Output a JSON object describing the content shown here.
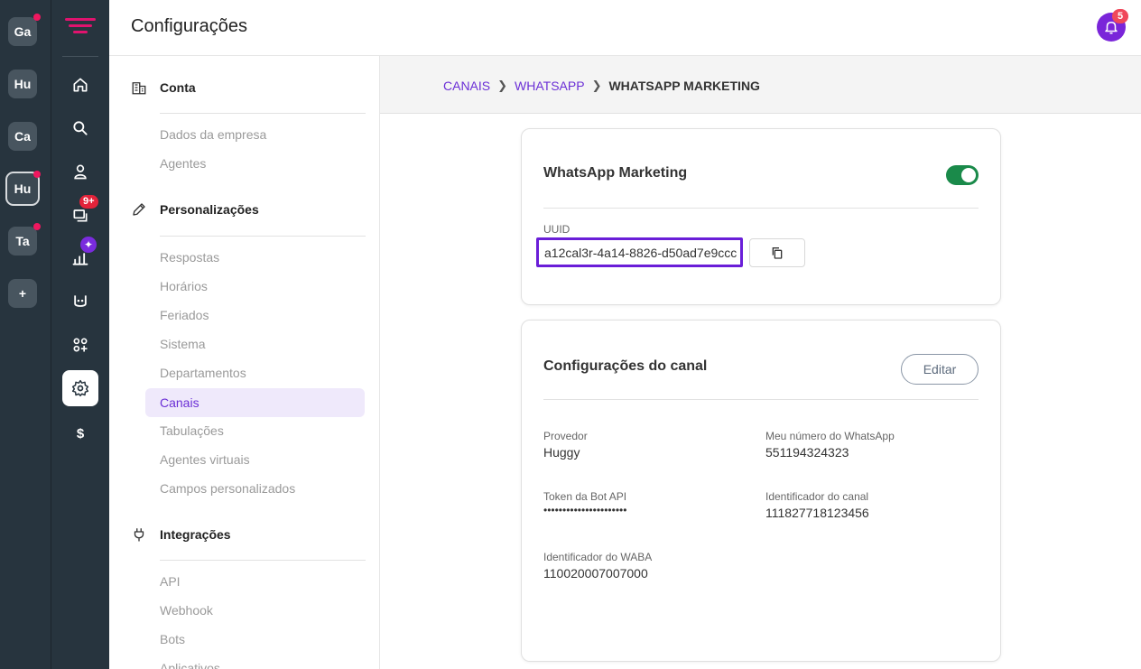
{
  "workspaces": [
    {
      "label": "Ga",
      "dot": true
    },
    {
      "label": "Hu",
      "dot": false
    },
    {
      "label": "Ca",
      "dot": false
    },
    {
      "label": "Hu",
      "dot": true,
      "active": true
    },
    {
      "label": "Ta",
      "dot": true
    },
    {
      "label": "+",
      "dot": false
    }
  ],
  "nav": {
    "chat_badge": "9+",
    "reports_badge": "✦"
  },
  "header": {
    "title": "Configurações",
    "notifications": "5"
  },
  "sidebar": {
    "conta": {
      "title": "Conta",
      "items": [
        "Dados da empresa",
        "Agentes"
      ]
    },
    "personalizacoes": {
      "title": "Personalizações",
      "items": [
        "Respostas",
        "Horários",
        "Feriados",
        "Sistema",
        "Departamentos",
        "Canais",
        "Tabulações",
        "Agentes virtuais",
        "Campos personalizados"
      ]
    },
    "integracoes": {
      "title": "Integrações",
      "items": [
        "API",
        "Webhook",
        "Bots",
        "Aplicativos"
      ]
    }
  },
  "breadcrumb": {
    "level1": "CANAIS",
    "level2": "WHATSAPP",
    "current": "WHATSAPP MARKETING"
  },
  "channel_card": {
    "title": "WhatsApp Marketing",
    "enabled": true,
    "uuid_label": "UUID",
    "uuid_value": "a12cal3r-4a14-8826-d50ad7e9ccc"
  },
  "config_card": {
    "title": "Configurações do canal",
    "edit_label": "Editar",
    "fields": {
      "provedor_label": "Provedor",
      "provedor_value": "Huggy",
      "numero_label": "Meu número do WhatsApp",
      "numero_value": "551194324323",
      "token_label": "Token da Bot API",
      "token_value": "••••••••••••••••••••••",
      "canal_label": "Identificador do canal",
      "canal_value": "111827718123456",
      "waba_label": "Identificador do WABA",
      "waba_value": "110020007007000"
    }
  },
  "colors": {
    "rail_bg": "#27343e",
    "accent_purple": "#6b2fd6",
    "toggle_on": "#1a8a4a",
    "highlight_border": "#6a1ed8"
  }
}
